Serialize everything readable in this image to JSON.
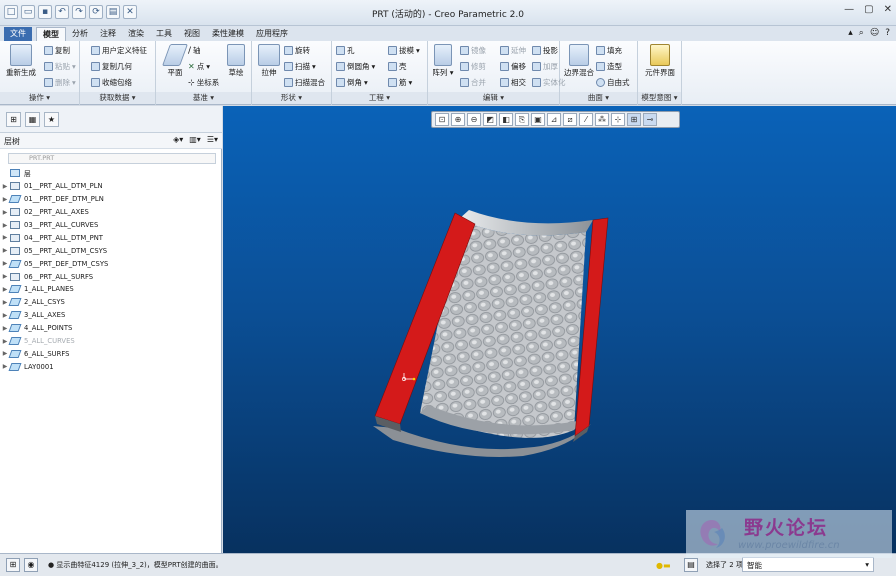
{
  "window": {
    "title": "PRT (活动的) - Creo Parametric 2.0"
  },
  "quick_access": [
    "新建",
    "打开",
    "保存",
    "撤销",
    "重做",
    "重新生成",
    "窗口",
    "关闭"
  ],
  "tabs": [
    "文件",
    "模型",
    "分析",
    "注释",
    "渲染",
    "工具",
    "视图",
    "柔性建模",
    "应用程序"
  ],
  "active_tab": "模型",
  "ribbon": {
    "operations": {
      "label": "操作",
      "regen": "重新生成",
      "copy": "复制",
      "paste": "粘贴",
      "delete": "删除"
    },
    "get_data": {
      "label": "获取数据",
      "udf": "用户定义特征",
      "copy_geom": "复制几何",
      "shrinkwrap": "收缩包络"
    },
    "datum": {
      "label": "基准",
      "plane": "平面",
      "axis": "轴",
      "point": "点",
      "csys": "坐标系",
      "sketch": "草绘"
    },
    "shapes": {
      "label": "形状",
      "extrude": "拉伸",
      "revolve": "旋转",
      "sweep": "扫描",
      "swept_blend": "扫描混合"
    },
    "engineering": {
      "label": "工程",
      "hole": "孔",
      "round": "倒圆角",
      "chamfer": "倒角",
      "draft": "拔模",
      "shell": "壳",
      "rib": "筋"
    },
    "editing": {
      "label": "编辑",
      "pattern": "阵列",
      "mirror": "镜像",
      "merge": "合并",
      "trim": "修剪",
      "extend": "延伸",
      "offset": "偏移",
      "intersect": "相交",
      "project": "投影",
      "thicken": "加厚",
      "solidify": "实体化"
    },
    "surfaces": {
      "label": "曲面",
      "boundary_blend": "边界混合",
      "fill": "填充",
      "style": "造型",
      "freestyle": "自由式"
    },
    "model_intent": {
      "label": "模型意图",
      "component_interface": "元件界面"
    }
  },
  "left_panel": {
    "header": "层树",
    "search_placeholder": "PRT.PRT",
    "root": "层",
    "layers": [
      {
        "name": "01__PRT_ALL_DTM_PLN",
        "icon": "dtm",
        "dim": false
      },
      {
        "name": "01__PRT_DEF_DTM_PLN",
        "icon": "lay",
        "dim": false
      },
      {
        "name": "02__PRT_ALL_AXES",
        "icon": "dtm",
        "dim": false
      },
      {
        "name": "03__PRT_ALL_CURVES",
        "icon": "dtm",
        "dim": false
      },
      {
        "name": "04__PRT_ALL_DTM_PNT",
        "icon": "dtm",
        "dim": false
      },
      {
        "name": "05__PRT_ALL_DTM_CSYS",
        "icon": "dtm",
        "dim": false
      },
      {
        "name": "05__PRT_DEF_DTM_CSYS",
        "icon": "lay",
        "dim": false
      },
      {
        "name": "06__PRT_ALL_SURFS",
        "icon": "dtm",
        "dim": false
      },
      {
        "name": "1_ALL_PLANES",
        "icon": "lay",
        "dim": false
      },
      {
        "name": "2_ALL_CSYS",
        "icon": "lay",
        "dim": false
      },
      {
        "name": "3_ALL_AXES",
        "icon": "lay",
        "dim": false
      },
      {
        "name": "4_ALL_POINTS",
        "icon": "lay",
        "dim": false
      },
      {
        "name": "5_ALL_CURVES",
        "icon": "lay",
        "dim": true
      },
      {
        "name": "6_ALL_SURFS",
        "icon": "lay",
        "dim": false
      },
      {
        "name": "LAY0001",
        "icon": "lay",
        "dim": false
      }
    ]
  },
  "status": {
    "message": "显示曲特征4129 (拉伸_3_2)，模型PRT创建的曲面。",
    "selection": "选择了 2 项",
    "filter": "智能"
  },
  "watermark": {
    "title": "野火论坛",
    "url": "www.proewildfire.cn"
  },
  "colors": {
    "viewport_top": "#0a62b8",
    "viewport_bottom": "#07315f",
    "part_red": "#d41a1a",
    "part_grey": "#a9adb3",
    "ribbon_tab": "#3b6db0"
  }
}
